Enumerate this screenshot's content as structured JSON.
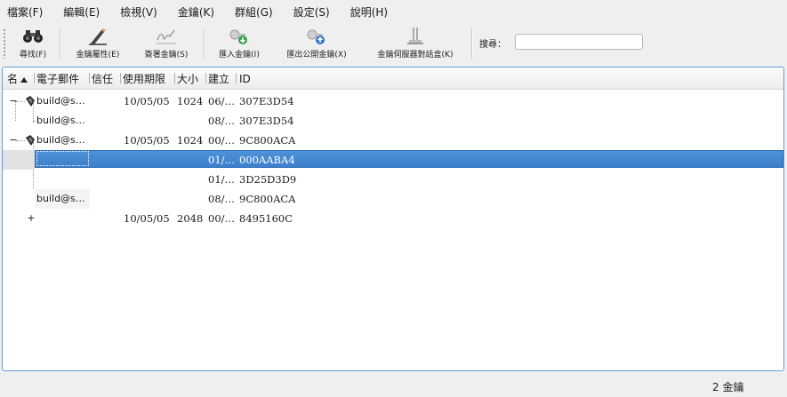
{
  "menu": [
    {
      "label": "檔案(F)",
      "name": "menu-file"
    },
    {
      "label": "編輯(E)",
      "name": "menu-edit"
    },
    {
      "label": "檢視(V)",
      "name": "menu-view"
    },
    {
      "label": "金鑰(K)",
      "name": "menu-keys"
    },
    {
      "label": "群組(G)",
      "name": "menu-groups"
    },
    {
      "label": "設定(S)",
      "name": "menu-settings"
    },
    {
      "label": "說明(H)",
      "name": "menu-help"
    }
  ],
  "toolbar": {
    "find": "尋找(F)",
    "key_properties": "金鑰屬性(E)",
    "sign_key": "簽署金鑰(S)",
    "import_key": "匯入金鑰(I)",
    "export_public_key": "匯出公開金鑰(X)",
    "keyserver_dialog": "金鑰伺服器對話盒(K)",
    "search_label": "搜尋：",
    "search_value": ""
  },
  "columns": {
    "name": "名",
    "email": "電子郵件",
    "trust": "信任",
    "expiry": "使用期限",
    "size": "大小",
    "created": "建立",
    "id": "ID"
  },
  "rows": [
    {
      "expander": "−",
      "email": "build@s…",
      "expiry": "10/05/05",
      "size": "1024",
      "created": "06/…",
      "id": "307E3D54"
    },
    {
      "expander": "",
      "email": "build@s…",
      "expiry": "",
      "size": "",
      "created": "08/…",
      "id": "307E3D54"
    },
    {
      "expander": "−",
      "email": "build@s…",
      "expiry": "10/05/05",
      "size": "1024",
      "created": "00/…",
      "id": "9C800ACA"
    },
    {
      "expander": "",
      "email": "",
      "expiry": "",
      "size": "",
      "created": "01/…",
      "id": "000AABA4"
    },
    {
      "expander": "",
      "email": "",
      "expiry": "",
      "size": "",
      "created": "01/…",
      "id": "3D25D3D9"
    },
    {
      "expander": "",
      "email": "build@s…",
      "expiry": "",
      "size": "",
      "created": "08/…",
      "id": "9C800ACA"
    },
    {
      "expander": "+",
      "email": "",
      "expiry": "10/05/05",
      "size": "2048",
      "created": "00/…",
      "id": "8495160C"
    }
  ],
  "status": {
    "text": "2 金鑰"
  },
  "colors": {
    "selection": "#3d85d0",
    "panel_border": "#6a9bd8"
  },
  "icons": {
    "find": "binoculars-icon",
    "key_properties": "pen-icon",
    "sign_key": "signature-icon",
    "import_key": "key-import-icon",
    "export_public_key": "key-export-icon",
    "keyserver_dialog": "keyserver-icon",
    "keypair": "keypair-icon"
  }
}
